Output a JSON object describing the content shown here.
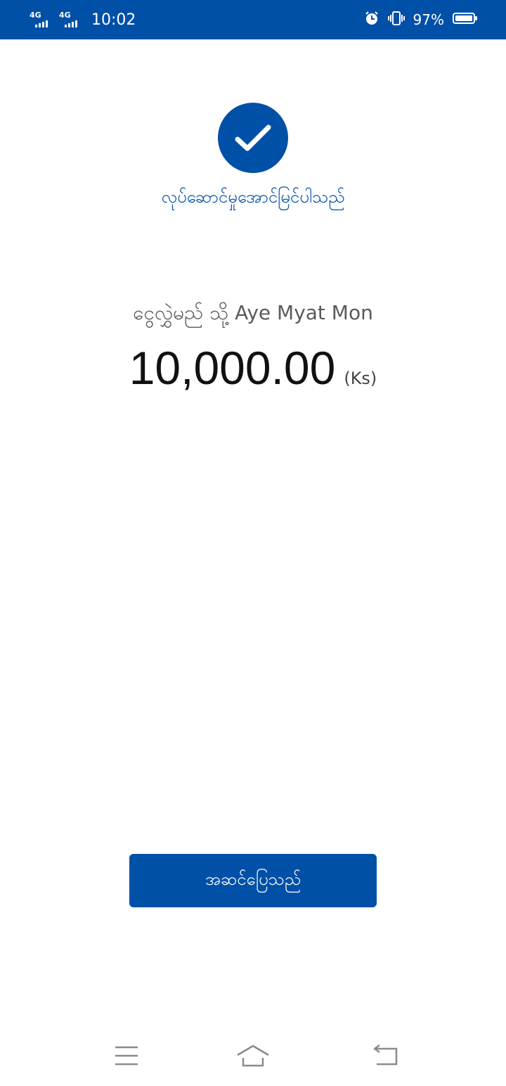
{
  "status_bar": {
    "network_1": "4G",
    "network_2": "4G",
    "time": "10:02",
    "battery_percent": "97%",
    "icons": [
      "signal-4g-icon",
      "signal-4g-icon",
      "alarm-icon",
      "vibrate-icon",
      "battery-icon"
    ],
    "background": "#0050a8"
  },
  "result": {
    "icon": "check-icon",
    "message": "လုပ်ဆောင်မှုအောင်မြင်ပါသည်"
  },
  "transfer": {
    "recipient_text": "ငွေလွှဲမည် သို့ Aye Myat Mon",
    "amount": "10,000.00",
    "currency": "(Ks)"
  },
  "actions": {
    "done_label": "အဆင်ပြေသည်"
  },
  "nav": {
    "icons": [
      "menu-icon",
      "home-icon",
      "back-icon"
    ]
  },
  "colors": {
    "accent": "#0050a8",
    "muted_text": "#5a5a5a"
  }
}
